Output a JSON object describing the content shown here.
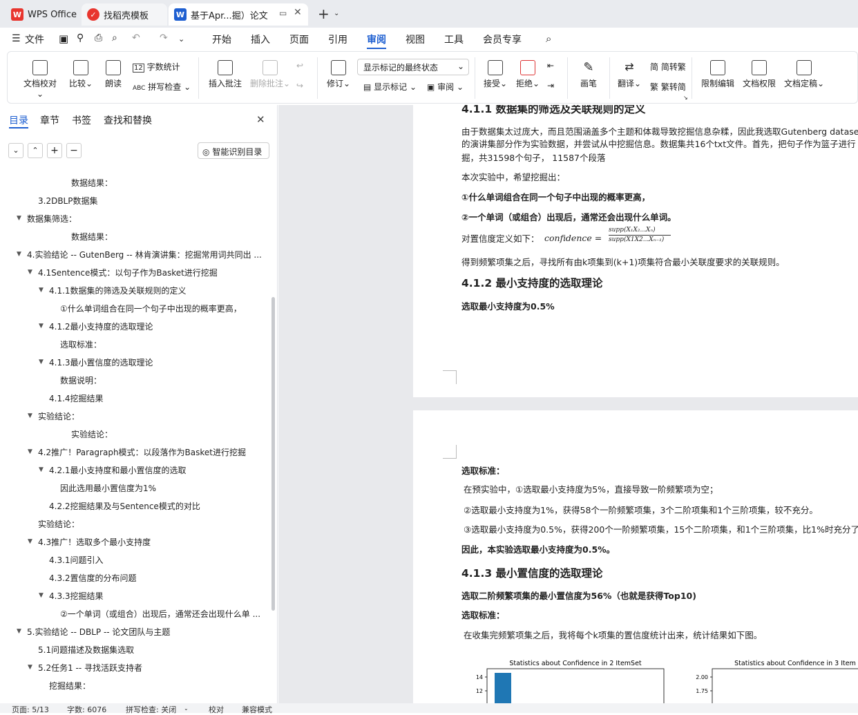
{
  "tabs": [
    {
      "label": "WPS Office",
      "icon": "wps-logo-icon"
    },
    {
      "label": "找稻壳模板",
      "icon": "docer-icon"
    },
    {
      "label": "基于Apr...掘）论文",
      "icon": "word-doc-icon"
    }
  ],
  "menu": {
    "file": "文件",
    "items": [
      "开始",
      "插入",
      "页面",
      "引用",
      "审阅",
      "视图",
      "工具",
      "会员专享"
    ],
    "active": "审阅"
  },
  "ribbon": {
    "doc_proof": "文档校对",
    "compare": "比较",
    "read": "朗读",
    "word_count": "字数统计",
    "spell_check": "拼写检查",
    "insert_comment": "插入批注",
    "delete_comment": "删除批注",
    "revise": "修订",
    "markup_state": "显示标记的最终状态",
    "show_markup": "显示标记",
    "review": "审阅",
    "accept": "接受",
    "reject": "拒绝",
    "pen": "画笔",
    "translate": "翻译",
    "to_trad": "简转繁",
    "to_simp": "繁转简",
    "restrict": "限制编辑",
    "rights": "文档权限",
    "finalize": "文档定稿",
    "word_count_badge": "12"
  },
  "sidebar": {
    "tabs": [
      "目录",
      "章节",
      "书签",
      "查找和替换"
    ],
    "smart": "智能识别目录",
    "toc": [
      {
        "t": "数据结果：",
        "l": 4,
        "c": 0
      },
      {
        "t": "3.2DBLP数据集",
        "l": 2,
        "c": 0
      },
      {
        "t": "数据集筛选：",
        "l": 1,
        "c": 1
      },
      {
        "t": "数据结果：",
        "l": 4,
        "c": 0
      },
      {
        "t": "4.实验结论 -- GutenBerg -- 林肯演讲集：挖掘常用词共同出 ...",
        "l": 1,
        "c": 1
      },
      {
        "t": "4.1Sentence模式：以句子作为Basket进行挖掘",
        "l": 2,
        "c": 1
      },
      {
        "t": "4.1.1数据集的筛选及关联规则的定义",
        "l": 3,
        "c": 1
      },
      {
        "t": "①什么单词组合在同一个句子中出现的概率更高，",
        "l": 4,
        "c": 0
      },
      {
        "t": "4.1.2最小支持度的选取理论",
        "l": 3,
        "c": 1
      },
      {
        "t": "选取标准：",
        "l": 4,
        "c": 0
      },
      {
        "t": "4.1.3最小置信度的选取理论",
        "l": 3,
        "c": 1
      },
      {
        "t": "数据说明：",
        "l": 4,
        "c": 0
      },
      {
        "t": "4.1.4挖掘结果",
        "l": 3,
        "c": 0
      },
      {
        "t": "实验结论：",
        "l": 2,
        "c": 1
      },
      {
        "t": "实验结论：",
        "l": 4,
        "c": 0
      },
      {
        "t": "4.2推广！Paragraph模式：以段落作为Basket进行挖掘",
        "l": 2,
        "c": 1
      },
      {
        "t": "4.2.1最小支持度和最小置信度的选取",
        "l": 3,
        "c": 1
      },
      {
        "t": "因此选用最小置信度为1%",
        "l": 4,
        "c": 0
      },
      {
        "t": "4.2.2挖掘结果及与Sentence模式的对比",
        "l": 3,
        "c": 0
      },
      {
        "t": "实验结论：",
        "l": 2,
        "c": 0
      },
      {
        "t": "4.3推广！选取多个最小支持度",
        "l": 2,
        "c": 1
      },
      {
        "t": "4.3.1问题引入",
        "l": 3,
        "c": 0
      },
      {
        "t": "4.3.2置信度的分布问题",
        "l": 3,
        "c": 0
      },
      {
        "t": "4.3.3挖掘结果",
        "l": 3,
        "c": 1
      },
      {
        "t": "②一个单词（或组合）出现后，通常还会出现什么单 ...",
        "l": 4,
        "c": 0
      },
      {
        "t": "5.实验结论 -- DBLP -- 论文团队与主题",
        "l": 1,
        "c": 1
      },
      {
        "t": "5.1问题描述及数据集选取",
        "l": 2,
        "c": 0
      },
      {
        "t": "5.2任务1 -- 寻找活跃支持者",
        "l": 2,
        "c": 1
      },
      {
        "t": "挖掘结果：",
        "l": 3,
        "c": 0
      }
    ]
  },
  "page1": {
    "heading": "4.1.1 数据集的筛选及关联规则的定义",
    "p1": "由于数据集太过庞大，而且范围涵盖多个主题和体裁导致挖掘信息杂糅，因此我选取Gutenberg dataset",
    "p2": "的演讲集部分作为实验数据，并尝试从中挖掘信息。数据集共16个txt文件。首先，把句子作为篮子进行",
    "p3": "掘，共31598个句子， 11587个段落",
    "p4": "本次实验中，希望挖掘出：",
    "p5": "①什么单词组合在同一个句子中出现的概率更高，",
    "p6": "②一个单词（或组合）出现后，通常还会出现什么单词。",
    "p7": "对置信度定义如下：",
    "formula_lhs": "confidence =",
    "formula_num": "supp(X₁X₂...Xₙ)",
    "formula_den": "supp(X1X2...Xₙ₋₁)",
    "p8": "得到频繁项集之后，寻找所有由k项集到(k+1)项集符合最小关联度要求的关联规则。",
    "h2": "4.1.2 最小支持度的选取理论",
    "p9": "选取最小支持度为0.5%"
  },
  "page2": {
    "s1": "选取标准：",
    "l1": "在预实验中，①选取最小支持度为5%，直接导致一阶频繁项为空；",
    "l2": "②选取最小支持度为1%，获得58个一阶频繁项集，3个二阶项集和1个三阶项集，较不充分。",
    "l3": "③选取最小支持度为0.5%，获得200个一阶频繁项集，15个二阶项集，和1个三阶项集，比1%时充分了一",
    "l4": "因此，本实验选取最小支持度为0.5%。",
    "h3": "4.1.3 最小置信度的选取理论",
    "l5": "选取二阶频繁项集的最小置信度为56%（也就是获得Top10)",
    "s2": "选取标准：",
    "l6": "在收集完频繁项集之后，我将每个k项集的置信度统计出来，统计结果如下图。"
  },
  "chart_data": [
    {
      "type": "bar",
      "title": "Statistics about Confidence in 2 ItemSet",
      "ytick_labels": [
        "14",
        "12"
      ],
      "values": [
        14
      ],
      "color": "#1f77b4"
    },
    {
      "type": "bar",
      "title": "Statistics about Confidence in 3 Item",
      "ytick_labels": [
        "2.00",
        "1.75"
      ],
      "values": []
    }
  ],
  "status": {
    "page": "页面: 5/13",
    "words": "字数: 6076",
    "spell": "拼写检查: 关闭",
    "proof": "校对",
    "compat": "兼容模式"
  },
  "colors": {
    "accent": "#1e5fd1",
    "wps_red": "#e8352e"
  }
}
